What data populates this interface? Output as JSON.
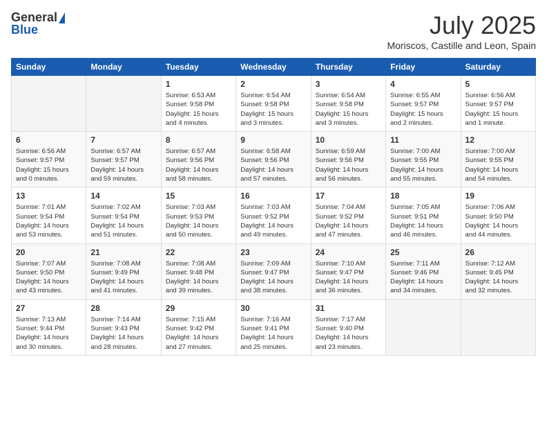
{
  "header": {
    "logo_general": "General",
    "logo_blue": "Blue",
    "month": "July 2025",
    "location": "Moriscos, Castille and Leon, Spain"
  },
  "calendar": {
    "days_of_week": [
      "Sunday",
      "Monday",
      "Tuesday",
      "Wednesday",
      "Thursday",
      "Friday",
      "Saturday"
    ],
    "weeks": [
      [
        {
          "day": "",
          "info": ""
        },
        {
          "day": "",
          "info": ""
        },
        {
          "day": "1",
          "info": "Sunrise: 6:53 AM\nSunset: 9:58 PM\nDaylight: 15 hours\nand 4 minutes."
        },
        {
          "day": "2",
          "info": "Sunrise: 6:54 AM\nSunset: 9:58 PM\nDaylight: 15 hours\nand 3 minutes."
        },
        {
          "day": "3",
          "info": "Sunrise: 6:54 AM\nSunset: 9:58 PM\nDaylight: 15 hours\nand 3 minutes."
        },
        {
          "day": "4",
          "info": "Sunrise: 6:55 AM\nSunset: 9:57 PM\nDaylight: 15 hours\nand 2 minutes."
        },
        {
          "day": "5",
          "info": "Sunrise: 6:56 AM\nSunset: 9:57 PM\nDaylight: 15 hours\nand 1 minute."
        }
      ],
      [
        {
          "day": "6",
          "info": "Sunrise: 6:56 AM\nSunset: 9:57 PM\nDaylight: 15 hours\nand 0 minutes."
        },
        {
          "day": "7",
          "info": "Sunrise: 6:57 AM\nSunset: 9:57 PM\nDaylight: 14 hours\nand 59 minutes."
        },
        {
          "day": "8",
          "info": "Sunrise: 6:57 AM\nSunset: 9:56 PM\nDaylight: 14 hours\nand 58 minutes."
        },
        {
          "day": "9",
          "info": "Sunrise: 6:58 AM\nSunset: 9:56 PM\nDaylight: 14 hours\nand 57 minutes."
        },
        {
          "day": "10",
          "info": "Sunrise: 6:59 AM\nSunset: 9:56 PM\nDaylight: 14 hours\nand 56 minutes."
        },
        {
          "day": "11",
          "info": "Sunrise: 7:00 AM\nSunset: 9:55 PM\nDaylight: 14 hours\nand 55 minutes."
        },
        {
          "day": "12",
          "info": "Sunrise: 7:00 AM\nSunset: 9:55 PM\nDaylight: 14 hours\nand 54 minutes."
        }
      ],
      [
        {
          "day": "13",
          "info": "Sunrise: 7:01 AM\nSunset: 9:54 PM\nDaylight: 14 hours\nand 53 minutes."
        },
        {
          "day": "14",
          "info": "Sunrise: 7:02 AM\nSunset: 9:54 PM\nDaylight: 14 hours\nand 51 minutes."
        },
        {
          "day": "15",
          "info": "Sunrise: 7:03 AM\nSunset: 9:53 PM\nDaylight: 14 hours\nand 50 minutes."
        },
        {
          "day": "16",
          "info": "Sunrise: 7:03 AM\nSunset: 9:52 PM\nDaylight: 14 hours\nand 49 minutes."
        },
        {
          "day": "17",
          "info": "Sunrise: 7:04 AM\nSunset: 9:52 PM\nDaylight: 14 hours\nand 47 minutes."
        },
        {
          "day": "18",
          "info": "Sunrise: 7:05 AM\nSunset: 9:51 PM\nDaylight: 14 hours\nand 46 minutes."
        },
        {
          "day": "19",
          "info": "Sunrise: 7:06 AM\nSunset: 9:50 PM\nDaylight: 14 hours\nand 44 minutes."
        }
      ],
      [
        {
          "day": "20",
          "info": "Sunrise: 7:07 AM\nSunset: 9:50 PM\nDaylight: 14 hours\nand 43 minutes."
        },
        {
          "day": "21",
          "info": "Sunrise: 7:08 AM\nSunset: 9:49 PM\nDaylight: 14 hours\nand 41 minutes."
        },
        {
          "day": "22",
          "info": "Sunrise: 7:08 AM\nSunset: 9:48 PM\nDaylight: 14 hours\nand 39 minutes."
        },
        {
          "day": "23",
          "info": "Sunrise: 7:09 AM\nSunset: 9:47 PM\nDaylight: 14 hours\nand 38 minutes."
        },
        {
          "day": "24",
          "info": "Sunrise: 7:10 AM\nSunset: 9:47 PM\nDaylight: 14 hours\nand 36 minutes."
        },
        {
          "day": "25",
          "info": "Sunrise: 7:11 AM\nSunset: 9:46 PM\nDaylight: 14 hours\nand 34 minutes."
        },
        {
          "day": "26",
          "info": "Sunrise: 7:12 AM\nSunset: 9:45 PM\nDaylight: 14 hours\nand 32 minutes."
        }
      ],
      [
        {
          "day": "27",
          "info": "Sunrise: 7:13 AM\nSunset: 9:44 PM\nDaylight: 14 hours\nand 30 minutes."
        },
        {
          "day": "28",
          "info": "Sunrise: 7:14 AM\nSunset: 9:43 PM\nDaylight: 14 hours\nand 28 minutes."
        },
        {
          "day": "29",
          "info": "Sunrise: 7:15 AM\nSunset: 9:42 PM\nDaylight: 14 hours\nand 27 minutes."
        },
        {
          "day": "30",
          "info": "Sunrise: 7:16 AM\nSunset: 9:41 PM\nDaylight: 14 hours\nand 25 minutes."
        },
        {
          "day": "31",
          "info": "Sunrise: 7:17 AM\nSunset: 9:40 PM\nDaylight: 14 hours\nand 23 minutes."
        },
        {
          "day": "",
          "info": ""
        },
        {
          "day": "",
          "info": ""
        }
      ]
    ]
  }
}
